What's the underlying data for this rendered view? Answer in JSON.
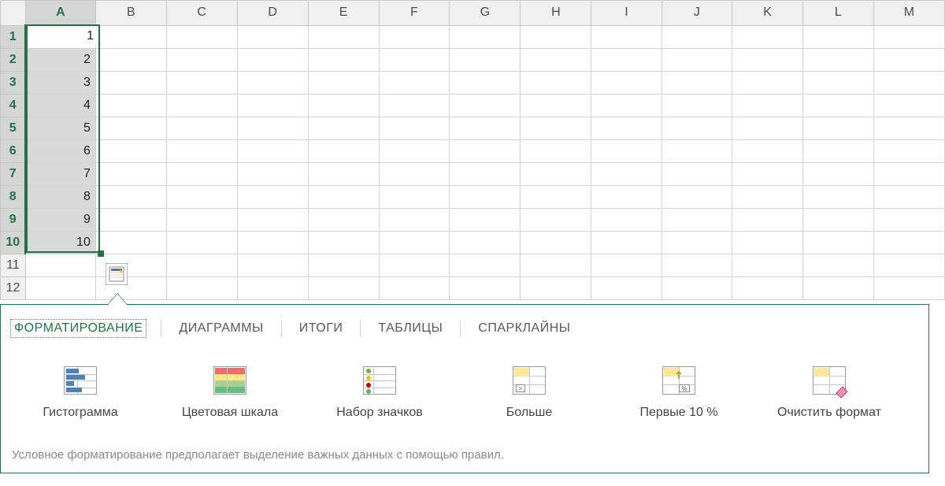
{
  "grid": {
    "columns": [
      "A",
      "B",
      "C",
      "D",
      "E",
      "F",
      "G",
      "H",
      "I",
      "J",
      "K",
      "L",
      "M"
    ],
    "rows": [
      1,
      2,
      3,
      4,
      5,
      6,
      7,
      8,
      9,
      10,
      11,
      12
    ],
    "values_A": [
      "1",
      "2",
      "3",
      "4",
      "5",
      "6",
      "7",
      "8",
      "9",
      "10"
    ],
    "selected_column": "A",
    "selected_rows": [
      1,
      2,
      3,
      4,
      5,
      6,
      7,
      8,
      9,
      10
    ]
  },
  "quickAnalysis": {
    "tabs": [
      "ФОРМАТИРОВАНИЕ",
      "ДИАГРАММЫ",
      "ИТОГИ",
      "ТАБЛИЦЫ",
      "СПАРКЛАЙНЫ"
    ],
    "active_tab": 0,
    "items": [
      {
        "label": "Гистограмма",
        "icon": "databar"
      },
      {
        "label": "Цветовая шкала",
        "icon": "colorscale"
      },
      {
        "label": "Набор значков",
        "icon": "iconset"
      },
      {
        "label": "Больше",
        "icon": "greater"
      },
      {
        "label": "Первые 10 %",
        "icon": "top10"
      },
      {
        "label": "Очистить формат",
        "icon": "clear"
      }
    ],
    "description": "Условное форматирование предполагает выделение важных данных с помощью правил."
  },
  "colors": {
    "accent": "#217346"
  }
}
